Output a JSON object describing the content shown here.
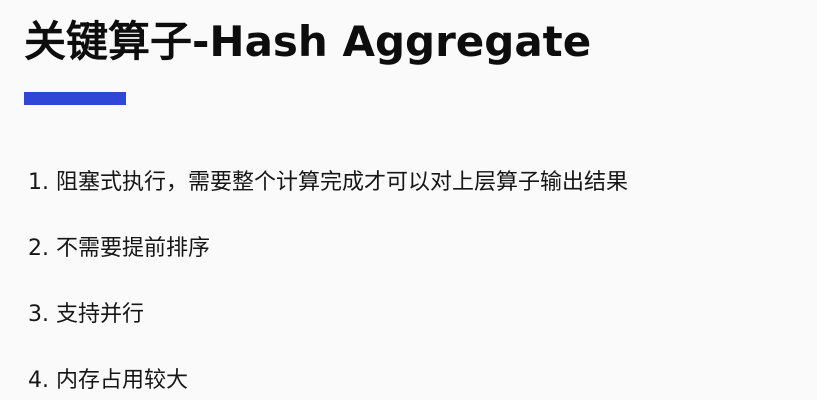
{
  "slide": {
    "title": "关键算子-Hash Aggregate",
    "accent_color": "#2f46d6",
    "points": [
      {
        "number": "1.",
        "text": "阻塞式执行，需要整个计算完成才可以对上层算子输出结果"
      },
      {
        "number": "2.",
        "text": "不需要提前排序"
      },
      {
        "number": "3.",
        "text": "支持并行"
      },
      {
        "number": "4.",
        "text": "内存占用较大"
      }
    ]
  }
}
